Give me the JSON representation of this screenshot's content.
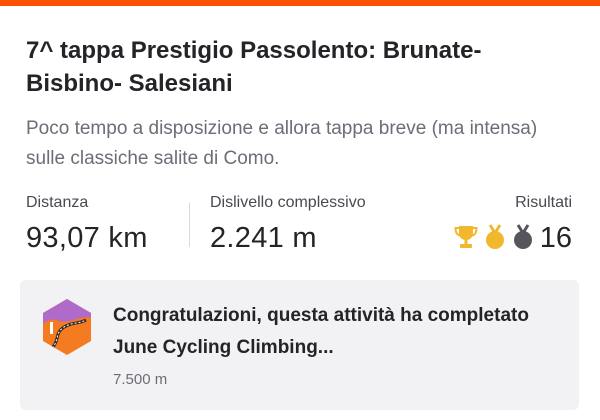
{
  "activity": {
    "title": "7^ tappa Prestigio Passolento: Brunate-Bisbino- Salesiani",
    "description": "Poco tempo a disposizione e allora tappa breve (ma intensa) sulle classiche salite di Como."
  },
  "stats": {
    "distance_label": "Distanza",
    "distance_value": "93,07 km",
    "elevation_label": "Dislivello complessivo",
    "elevation_value": "2.241 m",
    "results_label": "Risultati",
    "results_count": "16"
  },
  "results_icons": [
    "trophy-icon",
    "gold-medal-icon",
    "silver-medal-icon"
  ],
  "challenge": {
    "text": "Congratulazioni, questa attività ha completato June Cycling Climbing...",
    "sub": "7.500 m",
    "icon": "climbing-challenge-badge-icon"
  },
  "colors": {
    "accent": "#fc5200",
    "gold": "#f1b82d",
    "medal_dark": "#55555c",
    "badge_purple": "#b06ac9",
    "badge_orange": "#f47b20"
  }
}
